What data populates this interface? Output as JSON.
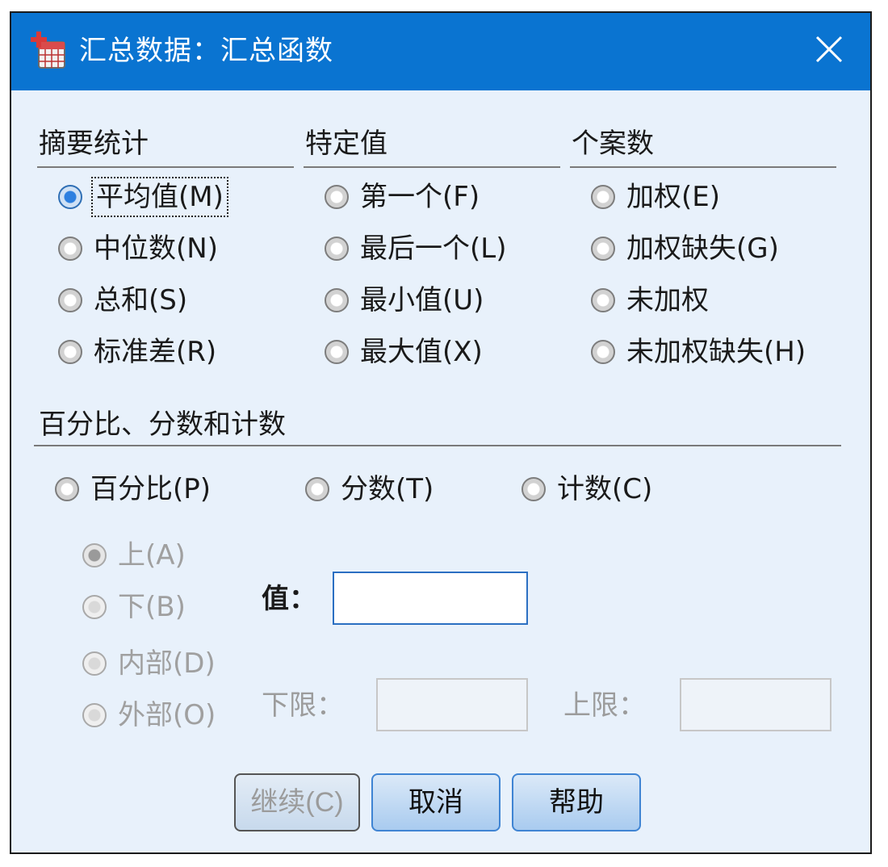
{
  "window": {
    "title": "汇总数据：汇总函数"
  },
  "groups": {
    "summary": {
      "title": "摘要统计",
      "options": [
        {
          "label": "平均值(M)",
          "checked": true
        },
        {
          "label": "中位数(N)",
          "checked": false
        },
        {
          "label": "总和(S)",
          "checked": false
        },
        {
          "label": "标准差(R)",
          "checked": false
        }
      ]
    },
    "specific": {
      "title": "特定值",
      "options": [
        {
          "label": "第一个(F)",
          "checked": false
        },
        {
          "label": "最后一个(L)",
          "checked": false
        },
        {
          "label": "最小值(U)",
          "checked": false
        },
        {
          "label": "最大值(X)",
          "checked": false
        }
      ]
    },
    "cases": {
      "title": "个案数",
      "options": [
        {
          "label": "加权(E)",
          "checked": false
        },
        {
          "label": "加权缺失(G)",
          "checked": false
        },
        {
          "label": "未加权",
          "checked": false
        },
        {
          "label": "未加权缺失(H)",
          "checked": false
        }
      ]
    }
  },
  "percent": {
    "title": "百分比、分数和计数",
    "options": [
      {
        "label": "百分比(P)",
        "checked": false
      },
      {
        "label": "分数(T)",
        "checked": false
      },
      {
        "label": "计数(C)",
        "checked": false
      }
    ],
    "direction": [
      {
        "label": "上(A)",
        "checked": true
      },
      {
        "label": "下(B)",
        "checked": false
      },
      {
        "label": "内部(D)",
        "checked": false
      },
      {
        "label": "外部(O)",
        "checked": false
      }
    ],
    "value_label": "值：",
    "value": "",
    "low_label": "下限：",
    "low_value": "",
    "high_label": "上限：",
    "high_value": ""
  },
  "buttons": {
    "continue": "继续(C)",
    "cancel": "取消",
    "help": "帮助"
  },
  "colors": {
    "titlebar": "#0a74d1",
    "dialog_bg": "#e8f1fb",
    "selected_radio": "#2c7fe0"
  }
}
